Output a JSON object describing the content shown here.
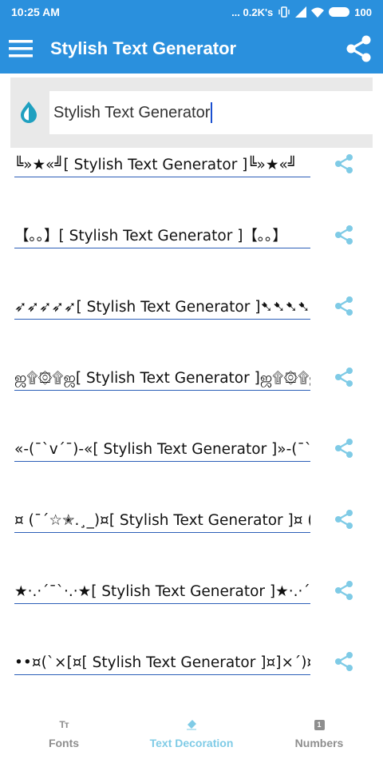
{
  "status_bar": {
    "time": "10:25 AM",
    "network_speed": "... 0.2K's",
    "battery": "100"
  },
  "app_bar": {
    "title": "Stylish Text Generator"
  },
  "input": {
    "value": "Stylish Text Generator"
  },
  "results": [
    {
      "text": "╚»★«╝[ Stylish Text Generator ]╚»★«╝"
    },
    {
      "text": "【｡｡】[ Stylish Text Generator ]【｡｡】"
    },
    {
      "text": "➶➶➶➶➶[ Stylish Text Generator ]➷➷➷➷➷"
    },
    {
      "text": "ஜ۩۞۩ஜ[ Stylish Text Generator ]ஜ۩۞۩ஜ"
    },
    {
      "text": "«-(¯`v´¯)-«[ Stylish Text Generator ]»-(¯`v´¯)-»"
    },
    {
      "text": "¤ (¯´☆✭.¸_)¤[ Stylish Text Generator ]¤ (¯´☆✭.¸_)¤"
    },
    {
      "text": "★·.·´¯`·.·★[ Stylish Text Generator ]★·.·´¯`·.·★"
    },
    {
      "text": "••¤(`×[¤[ Stylish Text Generator ]¤]×´)¤••"
    }
  ],
  "bottom_nav": {
    "fonts_label": "Fonts",
    "fonts_icon_text": "Tт",
    "decoration_label": "Text Decoration",
    "numbers_label": "Numbers",
    "numbers_icon_text": "1"
  },
  "colors": {
    "primary": "#2a90dd",
    "accent": "#7fcbe6",
    "icon_teal": "#1fa0c0",
    "underline": "#2c5fb8"
  }
}
